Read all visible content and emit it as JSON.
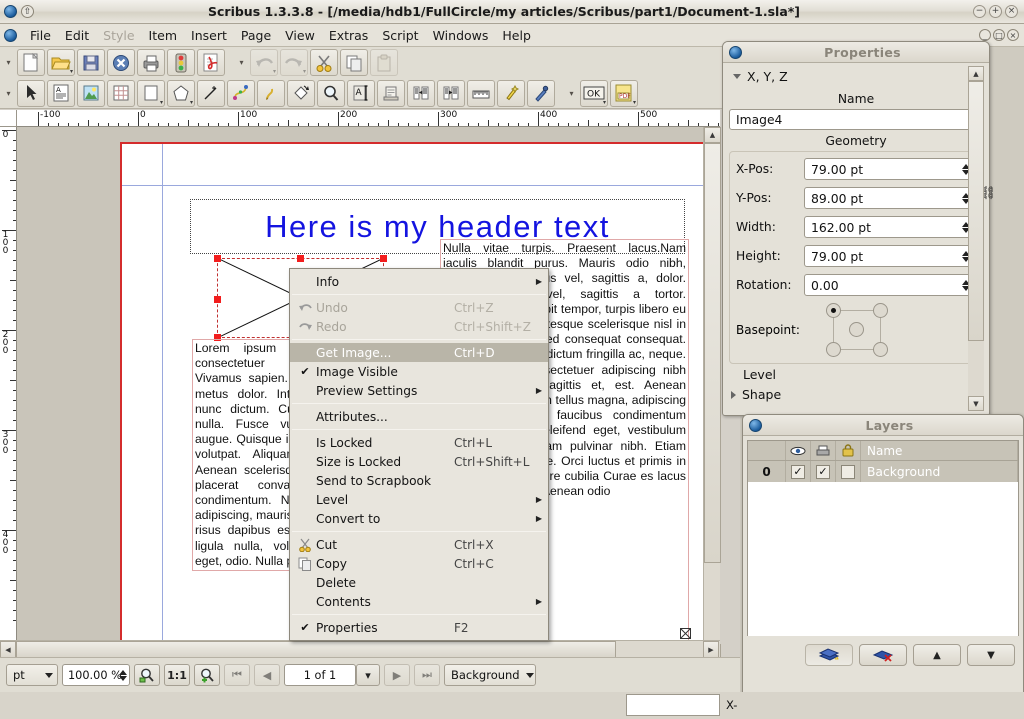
{
  "titlebar": {
    "title": "Scribus 1.3.3.8 - [/media/hdb1/FullCircle/my articles/Scribus/part1/Document-1.sla*]",
    "minimize": "−",
    "maximize": "+",
    "close": "×"
  },
  "menubar": {
    "items": [
      {
        "label": "File",
        "disabled": false
      },
      {
        "label": "Edit",
        "disabled": false
      },
      {
        "label": "Style",
        "disabled": true
      },
      {
        "label": "Item",
        "disabled": false
      },
      {
        "label": "Insert",
        "disabled": false
      },
      {
        "label": "Page",
        "disabled": false
      },
      {
        "label": "View",
        "disabled": false
      },
      {
        "label": "Extras",
        "disabled": false
      },
      {
        "label": "Script",
        "disabled": false
      },
      {
        "label": "Windows",
        "disabled": false
      },
      {
        "label": "Help",
        "disabled": false
      }
    ]
  },
  "toolbar_file": {
    "buttons": [
      {
        "name": "new-document-icon",
        "title": "New"
      },
      {
        "name": "open-document-icon",
        "title": "Open"
      },
      {
        "name": "save-document-icon",
        "title": "Save"
      },
      {
        "name": "close-document-icon",
        "title": "Close"
      },
      {
        "name": "print-document-icon",
        "title": "Print"
      },
      {
        "name": "preflight-verifier-icon",
        "title": "Preflight Verifier"
      },
      {
        "name": "export-pdf-icon",
        "title": "Save as PDF"
      }
    ]
  },
  "toolbar_edit": {
    "buttons": [
      {
        "name": "undo-icon",
        "title": "Undo",
        "disabled": true
      },
      {
        "name": "redo-icon",
        "title": "Redo",
        "disabled": true
      },
      {
        "name": "cut-icon",
        "title": "Cut"
      },
      {
        "name": "copy-icon",
        "title": "Copy"
      },
      {
        "name": "paste-icon",
        "title": "Paste",
        "disabled": true
      }
    ]
  },
  "toolbar_tools": {
    "buttons": [
      {
        "name": "select-item-icon",
        "title": "Select Item"
      },
      {
        "name": "insert-text-frame-icon",
        "title": "Insert Text Frame"
      },
      {
        "name": "insert-image-frame-icon",
        "title": "Insert Image Frame"
      },
      {
        "name": "insert-table-icon",
        "title": "Insert Table"
      },
      {
        "name": "insert-shape-icon",
        "title": "Insert Shape"
      },
      {
        "name": "insert-polygon-icon",
        "title": "Insert Polygon"
      },
      {
        "name": "insert-line-icon",
        "title": "Insert Line"
      },
      {
        "name": "insert-bezier-curve-icon",
        "title": "Insert Bezier Curve"
      },
      {
        "name": "insert-freehand-line-icon",
        "title": "Insert Freehand Line"
      },
      {
        "name": "rotate-item-icon",
        "title": "Rotate Item"
      },
      {
        "name": "zoom-icon",
        "title": "Zoom"
      },
      {
        "name": "edit-contents-icon",
        "title": "Edit Contents of Frame"
      },
      {
        "name": "edit-text-story-editor-icon",
        "title": "Edit Text with Story Editor"
      },
      {
        "name": "link-text-frames-icon",
        "title": "Link Text Frames"
      },
      {
        "name": "unlink-text-frames-icon",
        "title": "Unlink Text Frames"
      },
      {
        "name": "measurements-icon",
        "title": "Measurements"
      },
      {
        "name": "copy-item-properties-icon",
        "title": "Copy Item Properties"
      },
      {
        "name": "eye-dropper-icon",
        "title": "Eye Dropper"
      }
    ],
    "pdf_buttons": [
      {
        "name": "pdf-ok-button-icon",
        "label": "OK"
      },
      {
        "name": "pdf-tools-icon",
        "label": "PDF"
      }
    ]
  },
  "rulers": {
    "unit": "pt",
    "horizontal_labels": [
      "-100",
      "0",
      "100",
      "200",
      "300",
      "400",
      "500"
    ],
    "vertical_labels": [
      "0",
      "100",
      "200",
      "300",
      "400"
    ]
  },
  "document": {
    "header_frame_text": "Here is my header text",
    "left_text_frame": "Lorem ipsum dolor sit amet, consectetuer adipiscing elit. Vivamus sapien. Aliquam aliquam metus dolor. Integer quis est a nunc dictum. Curabitur dignissim nulla. Fusce vulputate lacus a augue. Quisque in libero non lorem volutpat. Aliquam erat volutpat. Aenean scelerisque quis, tristique placerat convallis, velit nec condimentum. Nulla facilisi. Duis adipiscing, mauris non pretium arcu risus dapibus est quam erat quis ligula nulla, volutpat eu, augue eget, odio. Nulla placerat",
    "right_text_frame": "Nulla vitae turpis. Praesent lacus.Nam iaculis blandit purus. Mauris odio nibh, hendrerit id, cursus vel, sagittis a, dolor. Donec ultrices vel, sagittis a tortor. Suspendisse suscipit tempor, turpis libero eu dictum nunc pellentesque scelerisque nisl in enim. Maecenas sed consequat consequat. Vestibul risus wisi, dictum fringilla ac, neque. Lorem ipsum consectetuer adipiscing nibh neque, aliquam sagittis et, est. Aenean quam enim. Aenean tellus magna, adipiscing et, sed Praesent faucibus condimentum tincidunt. Mauris eleifend eget, vestibulum eu nibh, diam. Nam pulvinar nibh. Etiam neque. Donec ut de. Orci luctus et primis in faucibus orci posuere cubilia Curae es lacus eu dui. Cras eros. Aenean odio",
    "image_frame_name": "Image4",
    "selection": "image-frame-selected"
  },
  "context_menu": {
    "items": [
      {
        "label": "Info",
        "accel": "",
        "submenu": true,
        "checked": false,
        "disabled": false,
        "selected": false,
        "icon": ""
      },
      {
        "separator": true
      },
      {
        "label": "Undo",
        "accel": "Ctrl+Z",
        "submenu": false,
        "checked": false,
        "disabled": true,
        "selected": false,
        "icon": "undo-icon"
      },
      {
        "label": "Redo",
        "accel": "Ctrl+Shift+Z",
        "submenu": false,
        "checked": false,
        "disabled": true,
        "selected": false,
        "icon": "redo-icon"
      },
      {
        "separator": true
      },
      {
        "label": "Get Image...",
        "accel": "Ctrl+D",
        "submenu": false,
        "checked": false,
        "disabled": false,
        "selected": true,
        "icon": ""
      },
      {
        "label": "Image Visible",
        "accel": "",
        "submenu": false,
        "checked": true,
        "disabled": false,
        "selected": false,
        "icon": ""
      },
      {
        "label": "Preview Settings",
        "accel": "",
        "submenu": true,
        "checked": false,
        "disabled": false,
        "selected": false,
        "icon": ""
      },
      {
        "separator": true
      },
      {
        "label": "Attributes...",
        "accel": "",
        "submenu": false,
        "checked": false,
        "disabled": false,
        "selected": false,
        "icon": ""
      },
      {
        "separator": true
      },
      {
        "label": "Is Locked",
        "accel": "Ctrl+L",
        "submenu": false,
        "checked": false,
        "disabled": false,
        "selected": false,
        "icon": ""
      },
      {
        "label": "Size is Locked",
        "accel": "Ctrl+Shift+L",
        "submenu": false,
        "checked": false,
        "disabled": false,
        "selected": false,
        "icon": ""
      },
      {
        "label": "Send to Scrapbook",
        "accel": "",
        "submenu": false,
        "checked": false,
        "disabled": false,
        "selected": false,
        "icon": ""
      },
      {
        "label": "Level",
        "accel": "",
        "submenu": true,
        "checked": false,
        "disabled": false,
        "selected": false,
        "icon": ""
      },
      {
        "label": "Convert to",
        "accel": "",
        "submenu": true,
        "checked": false,
        "disabled": false,
        "selected": false,
        "icon": ""
      },
      {
        "separator": true
      },
      {
        "label": "Cut",
        "accel": "Ctrl+X",
        "submenu": false,
        "checked": false,
        "disabled": false,
        "selected": false,
        "icon": "cut-icon"
      },
      {
        "label": "Copy",
        "accel": "Ctrl+C",
        "submenu": false,
        "checked": false,
        "disabled": false,
        "selected": false,
        "icon": "copy-icon"
      },
      {
        "label": "Delete",
        "accel": "",
        "submenu": false,
        "checked": false,
        "disabled": false,
        "selected": false,
        "icon": ""
      },
      {
        "label": "Contents",
        "accel": "",
        "submenu": true,
        "checked": false,
        "disabled": false,
        "selected": false,
        "icon": ""
      },
      {
        "separator": true
      },
      {
        "label": "Properties",
        "accel": "F2",
        "submenu": false,
        "checked": true,
        "disabled": false,
        "selected": false,
        "icon": ""
      }
    ]
  },
  "properties_palette": {
    "title": "Properties",
    "section": "X, Y, Z",
    "name_label": "Name",
    "name_value": "Image4",
    "geometry_label": "Geometry",
    "fields": [
      {
        "label": "X-Pos:",
        "value": "79.00 pt"
      },
      {
        "label": "Y-Pos:",
        "value": "89.00 pt"
      },
      {
        "label": "Width:",
        "value": "162.00 pt"
      },
      {
        "label": "Height:",
        "value": "79.00 pt"
      },
      {
        "label": "Rotation:",
        "value": "0.00"
      }
    ],
    "basepoint_label": "Basepoint:",
    "sections": [
      "Level",
      "Shape"
    ]
  },
  "layers_palette": {
    "title": "Layers",
    "columns": [
      "",
      "eye-icon",
      "print-icon",
      "lock-icon",
      "Name"
    ],
    "name_header": "Name",
    "rows": [
      {
        "number": "0",
        "visible": true,
        "printable": true,
        "locked": false,
        "name": "Background"
      }
    ],
    "buttons": [
      {
        "name": "add-layer-button",
        "label": ""
      },
      {
        "name": "delete-layer-button",
        "label": ""
      },
      {
        "name": "raise-layer-button",
        "label": "▲"
      },
      {
        "name": "lower-layer-button",
        "label": "▼"
      }
    ]
  },
  "statusbar": {
    "unit": "pt",
    "zoom_value": "100.00 %",
    "zoom_out_icon": "zoom-out-icon",
    "zoom_100_label": "1:1",
    "zoom_in_icon": "zoom-in-icon",
    "first_page_icon": "⏮",
    "prev_page_icon": "◀",
    "page_indicator": "1 of 1",
    "next_page_icon": "▶",
    "last_page_icon": "⏭",
    "layer_selector": "Background",
    "coord_label": "X-"
  },
  "colors": {
    "page_border": "#d42c2c",
    "margin_guide": "#9aa8dd",
    "selection_handle": "#f21d1d",
    "header_text": "#1414e0",
    "frame_outline": "#e0a8a8",
    "menu_highlight": "#b9b5a8",
    "window_bg": "#e0ddd3"
  }
}
